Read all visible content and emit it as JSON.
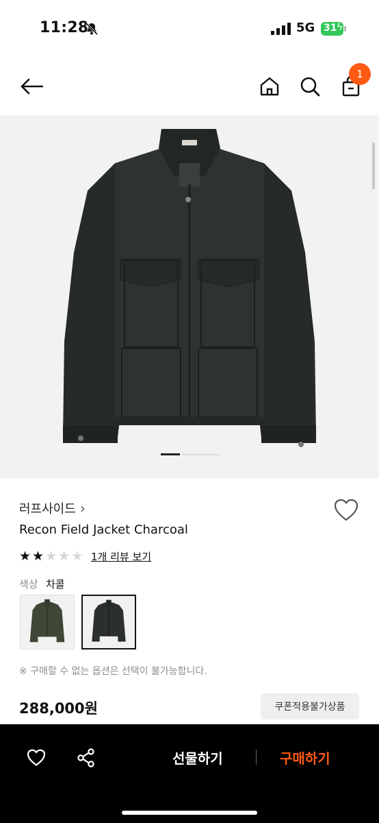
{
  "status_bar": {
    "time": "11:28",
    "network": "5G",
    "battery": "31"
  },
  "header": {
    "cart_count": "1"
  },
  "gallery": {
    "image_count": 3,
    "current_index": 1
  },
  "product": {
    "brand": "러프사이드",
    "brand_chevron": "›",
    "name": "Recon Field Jacket Charcoal",
    "rating": 2,
    "rating_max": 5,
    "review_link": "1개 리뷰 보기",
    "color_label": "색상",
    "color_value": "차콜",
    "swatches": [
      "khaki",
      "charcoal"
    ],
    "selected_swatch": "charcoal",
    "notice": "※ 구매할 수 없는 옵션은 선택이 불가능합니다.",
    "price": "288,000원",
    "coupon_label": "쿠폰적용불가상품"
  },
  "bottom_bar": {
    "gift_label": "선물하기",
    "buy_label": "구매하기"
  },
  "colors": {
    "accent": "#ff5a14",
    "jacket_charcoal": "#2b2f2e",
    "jacket_khaki": "#3f4636"
  }
}
